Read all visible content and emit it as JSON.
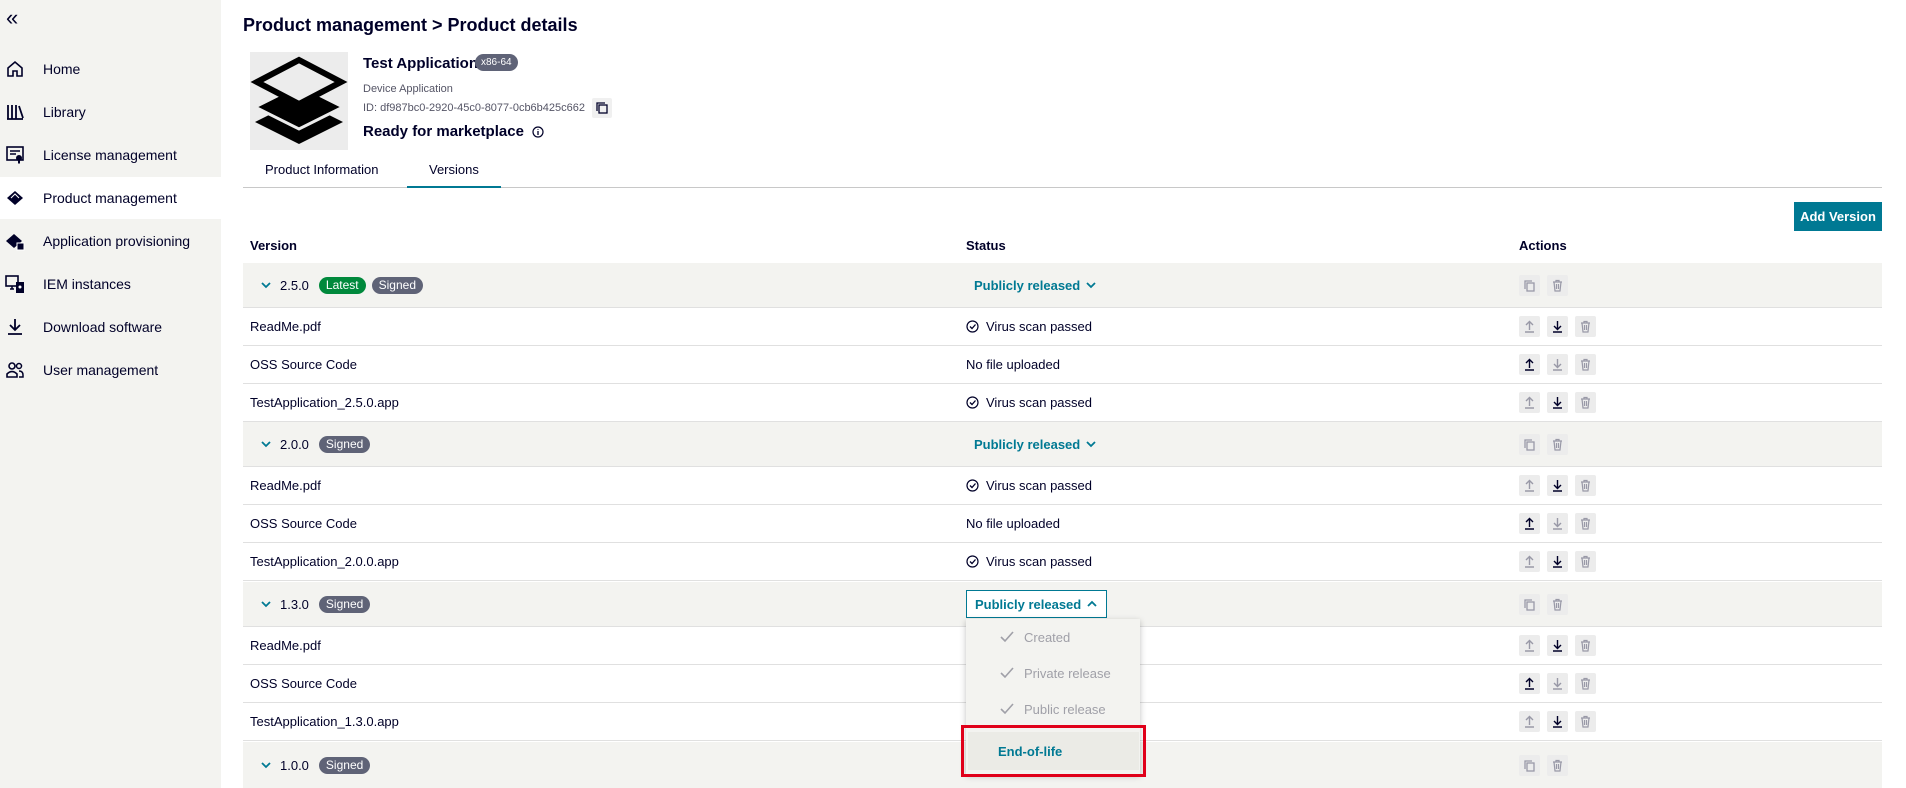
{
  "sidebar": {
    "collapse_icon": "double-chevron-left",
    "items": [
      {
        "label": "Home",
        "icon": "home-icon"
      },
      {
        "label": "Library",
        "icon": "library-icon"
      },
      {
        "label": "License management",
        "icon": "license-icon"
      },
      {
        "label": "Product management",
        "icon": "product-icon",
        "active": true
      },
      {
        "label": "Application provisioning",
        "icon": "provisioning-icon"
      },
      {
        "label": "IEM instances",
        "icon": "iem-icon"
      },
      {
        "label": "Download software",
        "icon": "download-icon"
      },
      {
        "label": "User management",
        "icon": "users-icon"
      }
    ]
  },
  "breadcrumb": "Product management > Product details",
  "product": {
    "name": "Test Application",
    "arch": "x86-64",
    "type": "Device Application",
    "id": "ID: df987bc0-2920-45c0-8077-0cb6b425c662",
    "market_status": "Ready for marketplace"
  },
  "tabs": {
    "info": "Product Information",
    "versions": "Versions"
  },
  "add_version": "Add Version",
  "table": {
    "headers": {
      "version": "Version",
      "status": "Status",
      "actions": "Actions"
    },
    "versions": [
      {
        "version": "2.5.0",
        "latest": "Latest",
        "signed": "Signed",
        "status": "Publicly released",
        "files": [
          {
            "name": "ReadMe.pdf",
            "status": "Virus scan passed"
          },
          {
            "name": "OSS Source Code",
            "status": "No file uploaded"
          },
          {
            "name": "TestApplication_2.5.0.app",
            "status": "Virus scan passed"
          }
        ]
      },
      {
        "version": "2.0.0",
        "signed": "Signed",
        "status": "Publicly released",
        "files": [
          {
            "name": "ReadMe.pdf",
            "status": "Virus scan passed"
          },
          {
            "name": "OSS Source Code",
            "status": "No file uploaded"
          },
          {
            "name": "TestApplication_2.0.0.app",
            "status": "Virus scan passed"
          }
        ]
      },
      {
        "version": "1.3.0",
        "signed": "Signed",
        "status": "Publicly released",
        "files": [
          {
            "name": "ReadMe.pdf"
          },
          {
            "name": "OSS Source Code"
          },
          {
            "name": "TestApplication_1.3.0.app"
          }
        ]
      },
      {
        "version": "1.0.0",
        "signed": "Signed"
      }
    ]
  },
  "status_menu": {
    "items": [
      "Created",
      "Private release",
      "Public release"
    ],
    "highlighted": "End-of-life"
  },
  "colors": {
    "accent": "#007993",
    "latest": "#00893c",
    "signed": "#5f6377",
    "highlight": "#e0001a"
  }
}
